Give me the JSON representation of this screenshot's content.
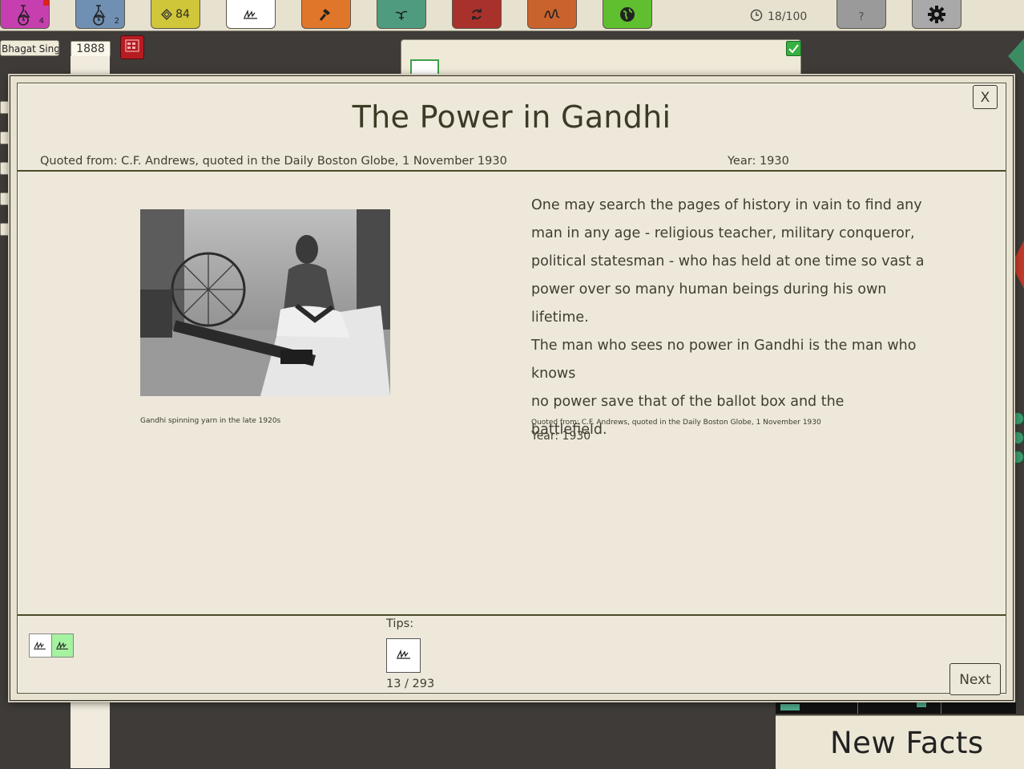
{
  "toolbar": {
    "resource_3_count": "84",
    "turn_counter": "18/100",
    "help_label": "?",
    "sub_1": "4",
    "sub_2": "2",
    "colors": {
      "btn1": "#c63fae",
      "btn2": "#6f8fb3",
      "btn3": "#cfc63a",
      "btn4": "#ffffff",
      "btn5": "#e0762a",
      "btn6": "#4f9b80",
      "btn7": "#a8312c",
      "btn8": "#c9622c",
      "btn9": "#5fbf2e",
      "help": "#9a9a9a",
      "settings": "#a9a9a9"
    },
    "icons": [
      "flask-clock-icon",
      "flask-clock-icon",
      "diamond-icon",
      "signature-icon",
      "hammer-icon",
      "plant-icon",
      "cycle-icon",
      "script-icon",
      "globe-icon",
      "clock-icon",
      "gear-icon"
    ]
  },
  "player": {
    "name": "Bhagat Singh",
    "year": "1888"
  },
  "modal": {
    "title": "The Power in Gandhi",
    "source": "Quoted from: C.F. Andrews, quoted in the Daily Boston Globe, 1 November 1930",
    "year": "Year: 1930",
    "photo_caption": "Gandhi spinning yarn in the late 1920s",
    "quote": "One may search the pages of history in vain to find any\nman in any age - religious teacher, military conqueror,\npolitical statesman - who has held at one time so vast a\npower over so many human beings during his own lifetime.\nThe man who sees no power in Gandhi is the man who knows\nno power save that of the ballot box and the\nbattlefield.",
    "quote_source": "Quoted from: C.F. Andrews, quoted in the Daily Boston Globe, 1 November 1930",
    "quote_year": "Year: 1930",
    "close_label": "X",
    "tips_label": "Tips:",
    "tips_counter": "13 / 293",
    "next_label": "Next"
  },
  "new_facts": {
    "label": "New Facts"
  }
}
